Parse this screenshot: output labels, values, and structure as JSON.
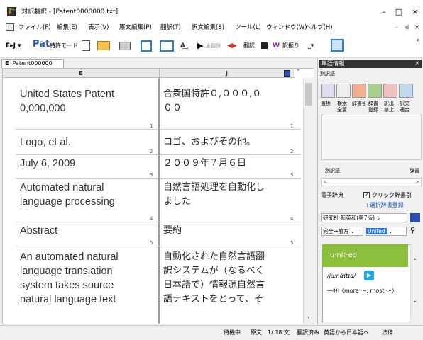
{
  "window": {
    "title": "対訳翻訳 - [Patent0000000.txt]",
    "minimize": "–",
    "maximize": "□",
    "close": "×"
  },
  "menu": [
    "ファイル(F)",
    "編集(E)",
    "表示(V)",
    "原文編集(P)",
    "翻訳(T)",
    "訳文編集(S)",
    "ツール(L)",
    "ウィンドウ(W)",
    "ヘルプ(H)"
  ],
  "menu_right": [
    "–",
    "ꟈ",
    "×"
  ],
  "toolbar": {
    "ej": "E▸J ▾",
    "pat": "Pat",
    "pat_mode": "特許モード",
    "all_translate": "全翻訳",
    "translate": "翻訳",
    "dict_pull": "訳振り",
    "more": "»"
  },
  "tab": {
    "label": "Patent000000"
  },
  "columns": {
    "e": "E",
    "j": "J"
  },
  "rows": [
    {
      "num": "1",
      "e": [
        "United States Patent",
        "0,000,000"
      ],
      "j": [
        "合衆国特許０,０００,０",
        "００"
      ]
    },
    {
      "num": "2",
      "e": [
        "Logo, et al."
      ],
      "j": [
        "ロゴ、およびその他。"
      ]
    },
    {
      "num": "3",
      "e": [
        "July 6, 2009"
      ],
      "j": [
        "２００９年７月６日"
      ]
    },
    {
      "num": "4",
      "e": [
        "Automated natural",
        "language processing"
      ],
      "j": [
        "自然言語処理を自動化し",
        "ました"
      ]
    },
    {
      "num": "5",
      "e": [
        "Abstract"
      ],
      "j": [
        "要約"
      ]
    },
    {
      "num": "",
      "e": [
        "An automated natural",
        "language translation",
        "system takes source",
        "natural language text"
      ],
      "j": [
        "自動化された自然言語翻",
        "訳システムが（なるべく",
        "日本語で）情報源自然言",
        "語テキストをとって、そ"
      ]
    }
  ],
  "right": {
    "panel_title": "単語情報",
    "panel_close": "×",
    "section1": "別訳語",
    "tools": [
      {
        "l1": "置換",
        "l2": ""
      },
      {
        "l1": "検索",
        "l2": "全置"
      },
      {
        "l1": "辞書引",
        "l2": ""
      },
      {
        "l1": "辞書",
        "l2": "登録"
      },
      {
        "l1": "訳出",
        "l2": "禁止"
      },
      {
        "l1": "訳文",
        "l2": "適合"
      }
    ],
    "section2": "別訳語",
    "section2_right": "辞書",
    "dict_label": "電子辞典",
    "click_lookup": "クリック辞書引",
    "select_dict": "+選択辞書登録",
    "dict_name": "研究社 新英和(第7版)",
    "match": "完全→前方",
    "united": "United",
    "headword": "ˈu·nit·ed",
    "pron": "/juːnάɪtɪd/",
    "def": "―⑭〈more ～; most ～〉"
  },
  "status": [
    "待機中",
    "原文",
    "1/ 18 文",
    "翻訳済み",
    "英語から日本語へ",
    "法律"
  ]
}
